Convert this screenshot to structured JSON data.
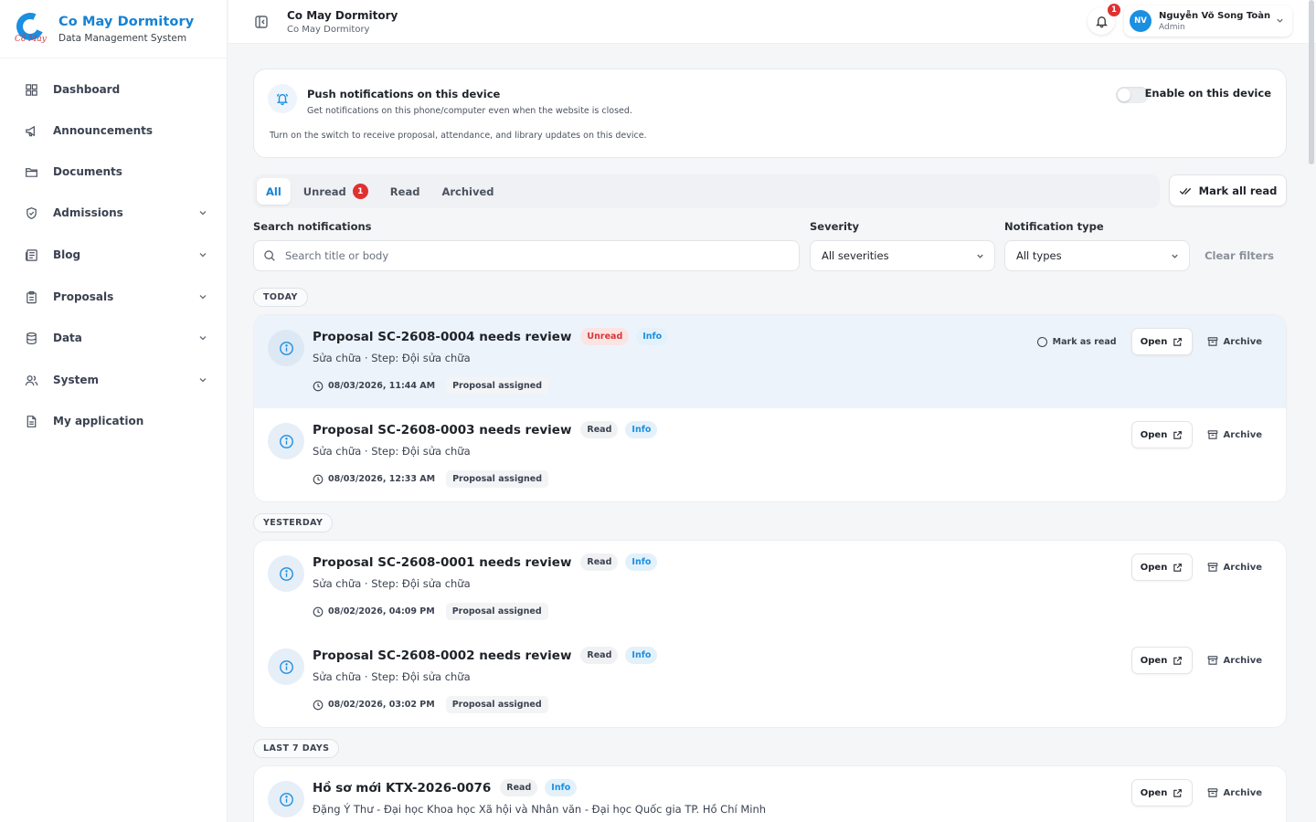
{
  "brand": {
    "name": "Co May Dormitory",
    "subtitle": "Data Management System",
    "logo_script": "Cô May"
  },
  "sidebar": {
    "items": [
      {
        "label": "Dashboard",
        "icon": "grid-icon"
      },
      {
        "label": "Announcements",
        "icon": "megaphone-icon"
      },
      {
        "label": "Documents",
        "icon": "folder-icon"
      },
      {
        "label": "Admissions",
        "icon": "shield-icon",
        "expandable": true
      },
      {
        "label": "Blog",
        "icon": "newspaper-icon",
        "expandable": true
      },
      {
        "label": "Proposals",
        "icon": "clipboard-icon",
        "expandable": true
      },
      {
        "label": "Data",
        "icon": "database-icon",
        "expandable": true
      },
      {
        "label": "System",
        "icon": "users-icon",
        "expandable": true
      },
      {
        "label": "My application",
        "icon": "document-icon"
      }
    ]
  },
  "header": {
    "title": "Co May Dormitory",
    "subtitle": "Co May Dormitory",
    "bell_count": "1",
    "user": {
      "initials": "NV",
      "name": "Nguyễn Võ Song Toàn",
      "role": "Admin"
    }
  },
  "push": {
    "title": "Push notifications on this device",
    "description": "Get notifications on this phone/computer even when the website is closed.",
    "note": "Turn on the switch to receive proposal, attendance, and library updates on this device.",
    "toggle_label": "Enable on this device",
    "toggle_on": false
  },
  "tabs": {
    "items": [
      {
        "label": "All",
        "active": true
      },
      {
        "label": "Unread",
        "badge": "1"
      },
      {
        "label": "Read"
      },
      {
        "label": "Archived"
      }
    ],
    "mark_all": "Mark all read"
  },
  "filters": {
    "search_label": "Search notifications",
    "search_placeholder": "Search title or body",
    "severity_label": "Severity",
    "severity_value": "All severities",
    "type_label": "Notification type",
    "type_value": "All types",
    "clear": "Clear filters"
  },
  "actions": {
    "mark_as_read": "Mark as read",
    "open": "Open",
    "archive": "Archive"
  },
  "groups": [
    {
      "label": "TODAY",
      "items": [
        {
          "title": "Proposal SC-2608-0004 needs review",
          "status": "Unread",
          "severity": "Info",
          "body": "Sửa chữa · Step: Đội sửa chữa",
          "time": "08/03/2026, 11:44 AM",
          "type": "Proposal assigned",
          "unread": true
        },
        {
          "title": "Proposal SC-2608-0003 needs review",
          "status": "Read",
          "severity": "Info",
          "body": "Sửa chữa · Step: Đội sửa chữa",
          "time": "08/03/2026, 12:33 AM",
          "type": "Proposal assigned",
          "unread": false
        }
      ]
    },
    {
      "label": "YESTERDAY",
      "items": [
        {
          "title": "Proposal SC-2608-0001 needs review",
          "status": "Read",
          "severity": "Info",
          "body": "Sửa chữa · Step: Đội sửa chữa",
          "time": "08/02/2026, 04:09 PM",
          "type": "Proposal assigned",
          "unread": false
        },
        {
          "title": "Proposal SC-2608-0002 needs review",
          "status": "Read",
          "severity": "Info",
          "body": "Sửa chữa · Step: Đội sửa chữa",
          "time": "08/02/2026, 03:02 PM",
          "type": "Proposal assigned",
          "unread": false
        }
      ]
    },
    {
      "label": "LAST 7 DAYS",
      "items": [
        {
          "title": "Hồ sơ mới KTX-2026-0076",
          "status": "Read",
          "severity": "Info",
          "body": "Đặng Ý Thư - Đại học Khoa học Xã hội và Nhân văn - Đại học Quốc gia TP. Hồ Chí Minh",
          "time": "",
          "type": "",
          "unread": false
        }
      ]
    }
  ]
}
